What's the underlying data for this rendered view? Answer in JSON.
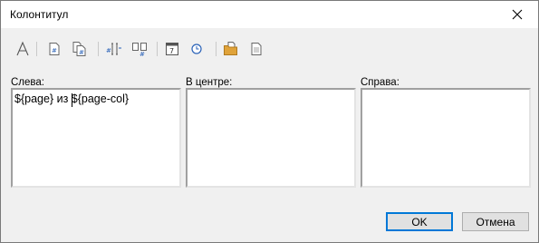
{
  "window": {
    "title": "Колонтитул"
  },
  "toolbar": {
    "buttons": [
      {
        "name": "font-icon"
      },
      {
        "name": "page-number-icon"
      },
      {
        "name": "page-count-icon"
      },
      {
        "name": "insert-field-icon"
      },
      {
        "name": "section-icon"
      },
      {
        "name": "date-icon"
      },
      {
        "name": "time-icon"
      },
      {
        "name": "file-path-icon"
      },
      {
        "name": "file-name-icon"
      }
    ]
  },
  "sections": {
    "left": {
      "label": "Слева:",
      "text": "${page} из ${page-col}"
    },
    "center": {
      "label": "В центре:",
      "text": ""
    },
    "right": {
      "label": "Справа:",
      "text": ""
    }
  },
  "buttons": {
    "ok": "OK",
    "cancel": "Отмена"
  },
  "colors": {
    "accent": "#0078d7",
    "folder": "#e0a33a"
  }
}
